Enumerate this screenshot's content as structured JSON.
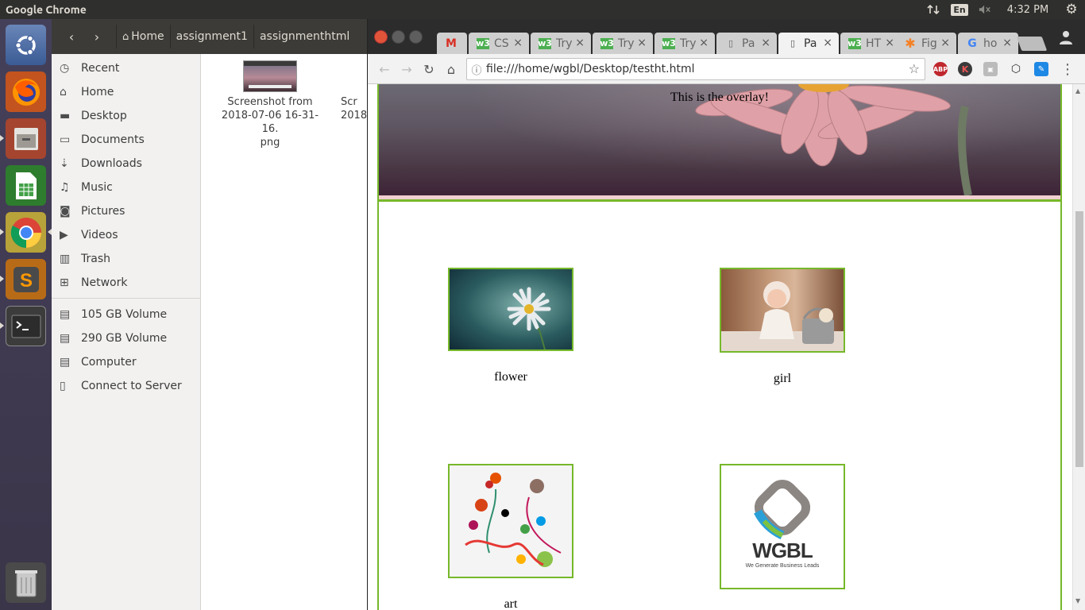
{
  "topbar": {
    "app_title": "Google Chrome",
    "language": "En",
    "time": "4:32 PM"
  },
  "launcher": {
    "apps": [
      "ubuntu-dash-icon",
      "firefox-icon",
      "files-icon",
      "calc-spreadsheet-icon",
      "chrome-icon",
      "sublime-text-icon",
      "terminal-icon",
      "trash-icon"
    ]
  },
  "files": {
    "breadcrumbs": [
      "Home",
      "assignment1",
      "assignmenthtml"
    ],
    "sidebar": [
      {
        "label": "Recent",
        "icon": "clock-icon"
      },
      {
        "label": "Home",
        "icon": "home-icon"
      },
      {
        "label": "Desktop",
        "icon": "folder-icon"
      },
      {
        "label": "Documents",
        "icon": "document-icon"
      },
      {
        "label": "Downloads",
        "icon": "download-icon"
      },
      {
        "label": "Music",
        "icon": "music-icon"
      },
      {
        "label": "Pictures",
        "icon": "camera-icon"
      },
      {
        "label": "Videos",
        "icon": "video-icon"
      },
      {
        "label": "Trash",
        "icon": "trash-icon"
      },
      {
        "label": "Network",
        "icon": "network-icon"
      }
    ],
    "devices": [
      {
        "label": "105 GB Volume",
        "icon": "drive-icon"
      },
      {
        "label": "290 GB Volume",
        "icon": "drive-icon"
      },
      {
        "label": "Computer",
        "icon": "drive-icon"
      },
      {
        "label": "Connect to Server",
        "icon": "server-icon"
      }
    ],
    "items": [
      {
        "name_line1": "Screenshot from",
        "name_line2": "2018-07-06 16-31-16.",
        "name_line3": "png"
      },
      {
        "name_line1": "Scr",
        "name_line2": "2018",
        "name_line3": ""
      }
    ]
  },
  "chrome": {
    "tabs": [
      {
        "label": "",
        "icon": "gmail-icon"
      },
      {
        "label": "CS",
        "icon": "w3schools-icon"
      },
      {
        "label": "Try",
        "icon": "w3schools-icon"
      },
      {
        "label": "Try",
        "icon": "w3schools-icon"
      },
      {
        "label": "Try",
        "icon": "w3schools-icon"
      },
      {
        "label": "Pa",
        "icon": "page-icon"
      },
      {
        "label": "Pa",
        "icon": "page-icon"
      },
      {
        "label": "HT",
        "icon": "w3schools-icon"
      },
      {
        "label": "Fig",
        "icon": "asterisk-icon"
      },
      {
        "label": "ho",
        "icon": "google-icon"
      }
    ],
    "url": "file:///home/wgbl/Desktop/testht.html",
    "extensions": [
      "abp-icon",
      "k-icon",
      "ext-icon",
      "cube-icon",
      "note-icon"
    ]
  },
  "page": {
    "overlay_text": "This is the overlay!",
    "gallery": [
      {
        "caption": "flower",
        "image": "daisy-photo"
      },
      {
        "caption": "girl",
        "image": "baby-girl-photo"
      },
      {
        "caption": "art",
        "image": "quilling-art-photo"
      },
      {
        "caption": "",
        "image": "wgbl-logo",
        "logo_text": "WGBL",
        "logo_tagline": "We Generate Business Leads"
      }
    ]
  },
  "colors": {
    "frame_green": "#76b82a",
    "topbar": "#2f2f2d",
    "launcher": "#3f3a52"
  }
}
